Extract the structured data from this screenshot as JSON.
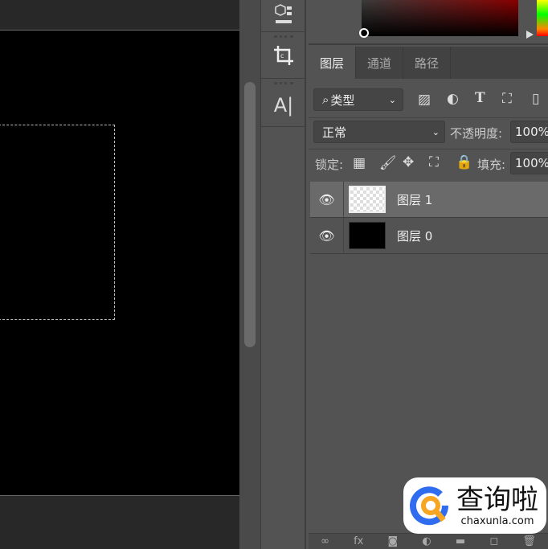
{
  "tabs": [
    {
      "label": "图层",
      "active": true
    },
    {
      "label": "通道"
    },
    {
      "label": "路径"
    }
  ],
  "filter": {
    "label": "类型",
    "icons": [
      "image-filter-icon",
      "adjustment-filter-icon",
      "type-filter-icon",
      "shape-filter-icon",
      "smart-object-filter-icon"
    ]
  },
  "blend": {
    "mode": "正常",
    "opacity_label": "不透明度:",
    "opacity": "100%"
  },
  "lock": {
    "label": "锁定:",
    "fill_label": "填充:",
    "fill": "100%"
  },
  "layers": [
    {
      "name": "图层 1",
      "selected": true,
      "thumb": "transparent"
    },
    {
      "name": "图层 0",
      "selected": false,
      "thumb": "black"
    }
  ],
  "tools": {
    "type_label": "A|"
  },
  "bottom_icons": [
    "link-icon",
    "fx",
    "mask-icon",
    "adjustment-icon",
    "folder-icon",
    "new-layer-icon",
    "trash-icon"
  ],
  "bottom_fx": "fx",
  "watermark": {
    "name": "查询啦",
    "url": "chaxunla.com",
    "colors": {
      "blue": "#2f6cf0",
      "orange": "#f6a623"
    }
  }
}
